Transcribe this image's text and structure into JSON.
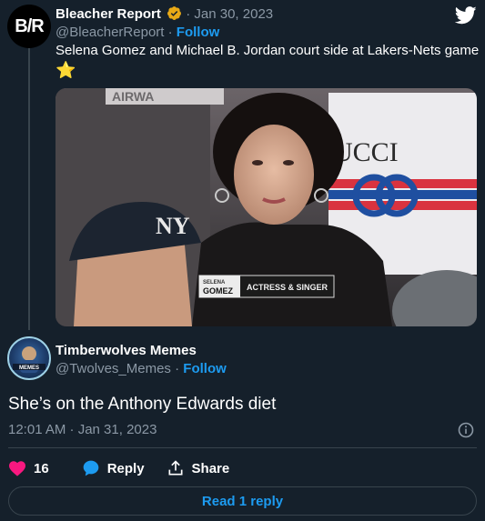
{
  "tweet": {
    "author_name": "Bleacher Report",
    "avatar_text": "B/R",
    "date": "Jan 30, 2023",
    "handle": "@BleacherReport",
    "follow_label": "Follow",
    "text": "Selena Gomez and Michael B. Jordan court side at Lakers-Nets game",
    "emoji": "⭐",
    "media": {
      "caption_name_top": "SELENA",
      "caption_name_bottom": "GOMEZ",
      "caption_title": "ACTRESS & SINGER",
      "shirt_brand": "UCCI",
      "banner_text": "AIRWA"
    }
  },
  "reply": {
    "author_name": "Timberwolves Memes",
    "handle": "@Twolves_Memes",
    "follow_label": "Follow",
    "text": "She’s on the Anthony Edwards diet",
    "timestamp": "12:01 AM · Jan 31, 2023",
    "likes": "16",
    "reply_label": "Reply",
    "share_label": "Share"
  },
  "read_replies_label": "Read 1 reply",
  "colors": {
    "background": "#15202b",
    "accent": "#1d9bf0",
    "muted": "#8b98a5",
    "like": "#f91880",
    "verified": "#e8a916",
    "border": "#38444d"
  },
  "icons": [
    "twitter-bird-icon",
    "verified-badge-icon",
    "info-icon",
    "heart-icon",
    "reply-bubble-icon",
    "share-icon"
  ]
}
